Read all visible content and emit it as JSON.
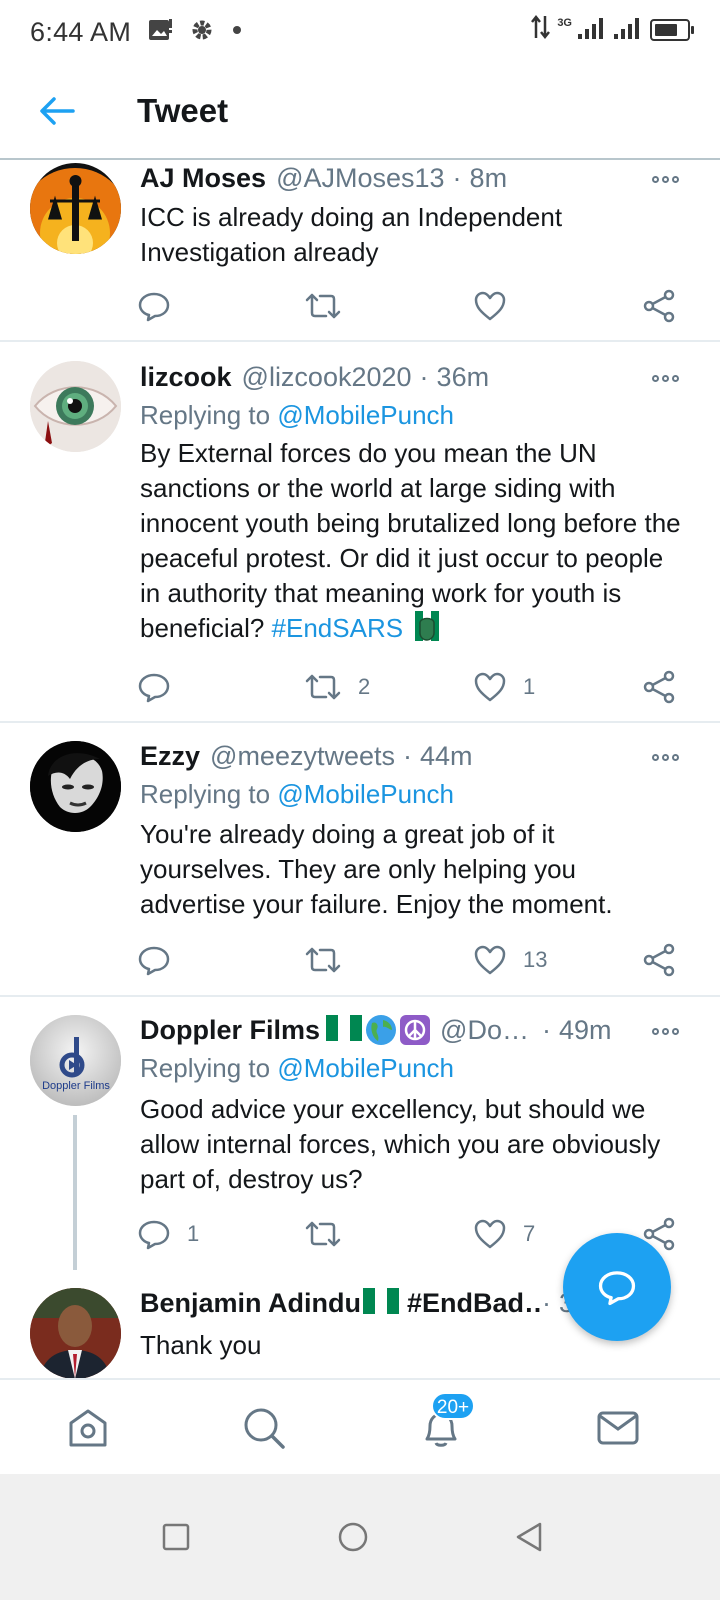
{
  "status_bar": {
    "time": "6:44 AM",
    "network": "3G",
    "battery_level": 0.8
  },
  "header": {
    "title": "Tweet"
  },
  "tweets": [
    {
      "name": "AJ Moses",
      "handle": "@AJMoses13",
      "separator": "·",
      "time": "8m",
      "replying_label": "",
      "replying_to": "",
      "text": "ICC is already doing an Independent Investigation already",
      "replies": "",
      "retweets": "",
      "likes": ""
    },
    {
      "name": "lizcook",
      "handle": "@lizcook2020",
      "separator": "·",
      "time": "36m",
      "replying_label": "Replying to",
      "replying_to": "@MobilePunch",
      "text": "By External forces do you mean the UN sanctions or the world at large siding with innocent youth being brutalized long before the peaceful protest. Or did it just occur to people in authority that meaning work for youth is beneficial?",
      "hashtag": "#EndSARS",
      "replies": "",
      "retweets": "2",
      "likes": "1"
    },
    {
      "name": "Ezzy",
      "handle": "@meezytweets",
      "separator": "·",
      "time": "44m",
      "replying_label": "Replying to",
      "replying_to": "@MobilePunch",
      "text": "You're already doing a great job of it yourselves. They are only helping you advertise your failure. Enjoy the moment.",
      "replies": "",
      "retweets": "",
      "likes": "13"
    },
    {
      "name": "Doppler Films",
      "handle": "@Do…",
      "separator": "·",
      "time": "49m",
      "replying_label": "Replying to",
      "replying_to": "@MobilePunch",
      "text": "Good advice your excellency, but should we allow internal forces, which you are obviously part of, destroy us?",
      "avatar_text": "Doppler Films",
      "replies": "1",
      "retweets": "",
      "likes": "7"
    },
    {
      "name": "Benjamin Adindu",
      "name_suffix": "#EndBad…",
      "separator": "·",
      "time": "3",
      "text": "Thank you"
    }
  ],
  "notifications_badge": "20+",
  "colors": {
    "accent": "#1da1f2",
    "link": "#1b95e0",
    "muted": "#657786"
  }
}
